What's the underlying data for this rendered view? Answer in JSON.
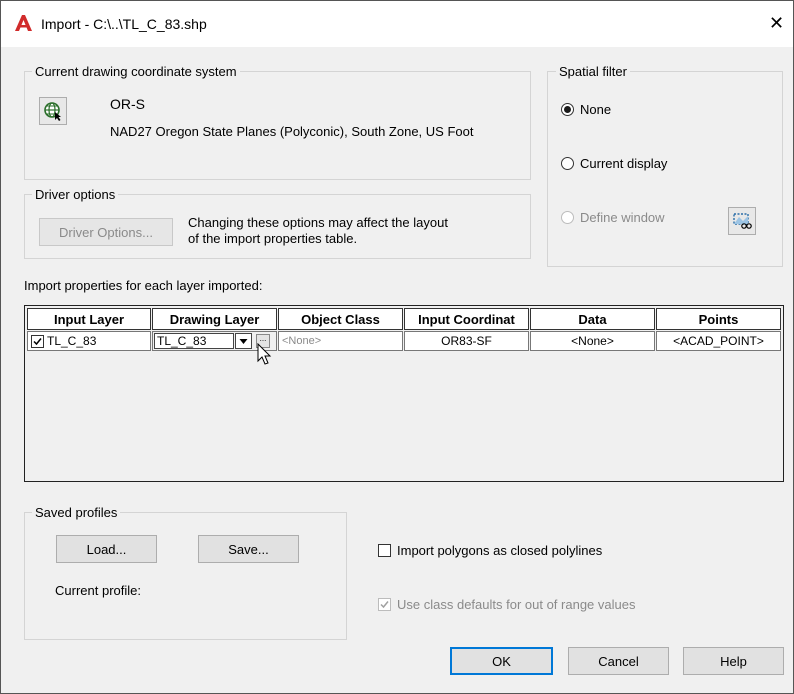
{
  "window": {
    "title": "Import - C:\\..\\TL_C_83.shp",
    "close_glyph": "✕"
  },
  "coord_system": {
    "group_label": "Current drawing coordinate system",
    "code": "OR-S",
    "description": "NAD27 Oregon State Planes (Polyconic), South Zone, US Foot"
  },
  "spatial_filter": {
    "group_label": "Spatial filter",
    "options": [
      {
        "label": "None",
        "checked": true,
        "disabled": false
      },
      {
        "label": "Current display",
        "checked": false,
        "disabled": false
      },
      {
        "label": "Define window",
        "checked": false,
        "disabled": true
      }
    ]
  },
  "driver_options": {
    "group_label": "Driver options",
    "button_label": "Driver Options...",
    "note_line1": "Changing these options may affect the layout",
    "note_line2": "of the import properties table."
  },
  "import_properties": {
    "label": "Import properties for each layer imported:",
    "columns": [
      "Input Layer",
      "Drawing Layer",
      "Object Class",
      "Input Coordinat",
      "Data",
      "Points"
    ],
    "rows": [
      {
        "checked": true,
        "input_layer": "TL_C_83",
        "drawing_layer": "TL_C_83",
        "object_class": "<None>",
        "input_coordinate": "OR83-SF",
        "data": "<None>",
        "points": "<ACAD_POINT>"
      }
    ],
    "ellipsis_glyph": "..."
  },
  "saved_profiles": {
    "group_label": "Saved profiles",
    "load_label": "Load...",
    "save_label": "Save...",
    "current_profile_label": "Current profile:"
  },
  "options": {
    "closed_polylines": {
      "label": "Import polygons as closed polylines",
      "checked": false
    },
    "class_defaults": {
      "label": "Use class defaults for out of range values",
      "checked": true,
      "disabled": true
    }
  },
  "buttons": {
    "ok": "OK",
    "cancel": "Cancel",
    "help": "Help"
  },
  "colors": {
    "app_icon": "#d12b2b",
    "default_button_border": "#0078d7",
    "dialog_bg": "#f0f0f0"
  }
}
